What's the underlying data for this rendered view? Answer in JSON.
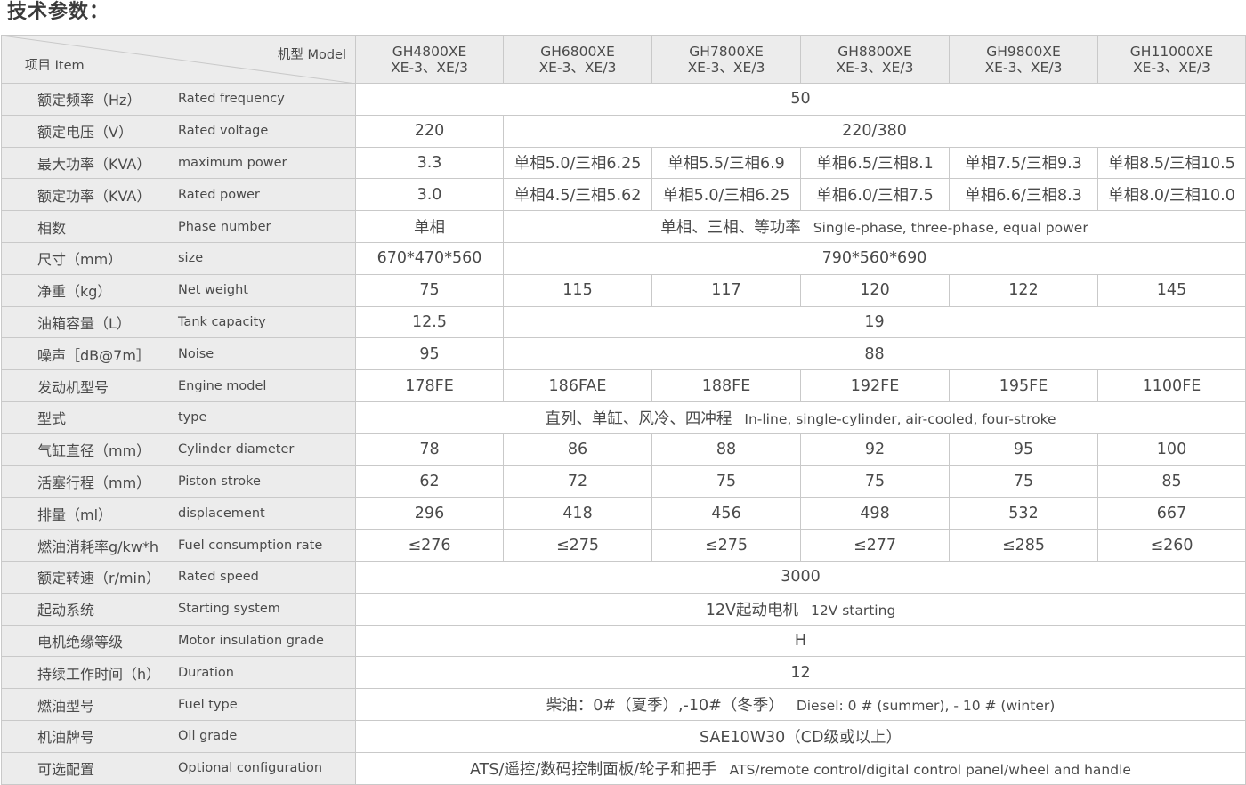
{
  "title": "技术参数：",
  "header": {
    "model_label": "机型 Model",
    "item_label": "项目 Item",
    "columns": [
      {
        "line1": "GH4800XE",
        "line2": "XE-3、XE/3"
      },
      {
        "line1": "GH6800XE",
        "line2": "XE-3、XE/3"
      },
      {
        "line1": "GH7800XE",
        "line2": "XE-3、XE/3"
      },
      {
        "line1": "GH8800XE",
        "line2": "XE-3、XE/3"
      },
      {
        "line1": "GH9800XE",
        "line2": "XE-3、XE/3"
      },
      {
        "line1": "GH11000XE",
        "line2": "XE-3、XE/3"
      }
    ]
  },
  "rows": [
    {
      "cn": "额定频率（Hz）",
      "en": "Rated frequency",
      "cells": [
        {
          "text": "50",
          "span": 6
        }
      ]
    },
    {
      "cn": "额定电压（V）",
      "en": "Rated voltage",
      "cells": [
        {
          "text": "220",
          "span": 1
        },
        {
          "text": "220/380",
          "span": 5
        }
      ]
    },
    {
      "cn": "最大功率（KVA）",
      "en": "maximum power",
      "cells": [
        {
          "text": "3.3",
          "span": 1
        },
        {
          "text": "单相5.0/三相6.25",
          "span": 1
        },
        {
          "text": "单相5.5/三相6.9",
          "span": 1
        },
        {
          "text": "单相6.5/三相8.1",
          "span": 1
        },
        {
          "text": "单相7.5/三相9.3",
          "span": 1
        },
        {
          "text": "单相8.5/三相10.5",
          "span": 1
        }
      ]
    },
    {
      "cn": "额定功率（KVA）",
      "en": "Rated power",
      "cells": [
        {
          "text": "3.0",
          "span": 1
        },
        {
          "text": "单相4.5/三相5.62",
          "span": 1
        },
        {
          "text": "单相5.0/三相6.25",
          "span": 1
        },
        {
          "text": "单相6.0/三相7.5",
          "span": 1
        },
        {
          "text": "单相6.6/三相8.3",
          "span": 1
        },
        {
          "text": "单相8.0/三相10.0",
          "span": 1
        }
      ]
    },
    {
      "cn": "相数",
      "en": "Phase number",
      "cells": [
        {
          "text": "单相",
          "span": 1
        },
        {
          "text": "单相、三相、等功率",
          "en": "Single-phase, three-phase, equal power",
          "span": 5
        }
      ]
    },
    {
      "cn": "尺寸（mm）",
      "en": "size",
      "cells": [
        {
          "text": "670*470*560",
          "span": 1
        },
        {
          "text": "790*560*690",
          "span": 5
        }
      ]
    },
    {
      "cn": "净重（kg）",
      "en": "Net weight",
      "cells": [
        {
          "text": "75",
          "span": 1
        },
        {
          "text": "115",
          "span": 1
        },
        {
          "text": "117",
          "span": 1
        },
        {
          "text": "120",
          "span": 1
        },
        {
          "text": "122",
          "span": 1
        },
        {
          "text": "145",
          "span": 1
        }
      ]
    },
    {
      "cn": "油箱容量（L）",
      "en": "Tank capacity",
      "cells": [
        {
          "text": "12.5",
          "span": 1
        },
        {
          "text": "19",
          "span": 5
        }
      ]
    },
    {
      "cn": "噪声［dB@7m］",
      "en": "Noise",
      "cells": [
        {
          "text": "95",
          "span": 1
        },
        {
          "text": "88",
          "span": 5
        }
      ]
    },
    {
      "cn": "发动机型号",
      "en": "Engine model",
      "cells": [
        {
          "text": "178FE",
          "span": 1
        },
        {
          "text": "186FAE",
          "span": 1
        },
        {
          "text": "188FE",
          "span": 1
        },
        {
          "text": "192FE",
          "span": 1
        },
        {
          "text": "195FE",
          "span": 1
        },
        {
          "text": "1100FE",
          "span": 1
        }
      ]
    },
    {
      "cn": "型式",
      "en": "type",
      "cells": [
        {
          "text": "直列、单缸、风冷、四冲程",
          "en": "In-line, single-cylinder, air-cooled, four-stroke",
          "span": 6
        }
      ]
    },
    {
      "cn": "气缸直径（mm）",
      "en": "Cylinder diameter",
      "cells": [
        {
          "text": "78",
          "span": 1
        },
        {
          "text": "86",
          "span": 1
        },
        {
          "text": "88",
          "span": 1
        },
        {
          "text": "92",
          "span": 1
        },
        {
          "text": "95",
          "span": 1
        },
        {
          "text": "100",
          "span": 1
        }
      ]
    },
    {
      "cn": "活塞行程（mm）",
      "en": "Piston stroke",
      "cells": [
        {
          "text": "62",
          "span": 1
        },
        {
          "text": "72",
          "span": 1
        },
        {
          "text": "75",
          "span": 1
        },
        {
          "text": "75",
          "span": 1
        },
        {
          "text": "75",
          "span": 1
        },
        {
          "text": "85",
          "span": 1
        }
      ]
    },
    {
      "cn": "排量（ml）",
      "en": "displacement",
      "cells": [
        {
          "text": "296",
          "span": 1
        },
        {
          "text": "418",
          "span": 1
        },
        {
          "text": "456",
          "span": 1
        },
        {
          "text": "498",
          "span": 1
        },
        {
          "text": "532",
          "span": 1
        },
        {
          "text": "667",
          "span": 1
        }
      ]
    },
    {
      "cn": "燃油消耗率g/kw*h",
      "en": "Fuel consumption rate",
      "cells": [
        {
          "text": "≤276",
          "span": 1
        },
        {
          "text": "≤275",
          "span": 1
        },
        {
          "text": "≤275",
          "span": 1
        },
        {
          "text": "≤277",
          "span": 1
        },
        {
          "text": "≤285",
          "span": 1
        },
        {
          "text": "≤260",
          "span": 1
        }
      ]
    },
    {
      "cn": "额定转速（r/min）",
      "en": "Rated speed",
      "cells": [
        {
          "text": "3000",
          "span": 6
        }
      ]
    },
    {
      "cn": "起动系统",
      "en": "Starting system",
      "cells": [
        {
          "text": "12V起动电机",
          "en": "12V starting",
          "span": 6
        }
      ]
    },
    {
      "cn": "电机绝缘等级",
      "en": "Motor insulation grade",
      "cells": [
        {
          "text": "H",
          "span": 6
        }
      ]
    },
    {
      "cn": "持续工作时间（h）",
      "en": "Duration",
      "cells": [
        {
          "text": "12",
          "span": 6
        }
      ]
    },
    {
      "cn": "燃油型号",
      "en": "Fuel type",
      "cells": [
        {
          "text": "柴油：0#（夏季）,-10#（冬季）",
          "en": "Diesel: 0 # (summer), - 10 # (winter)",
          "span": 6
        }
      ]
    },
    {
      "cn": "机油牌号",
      "en": "Oil grade",
      "cells": [
        {
          "text": "SAE10W30（CD级或以上）",
          "span": 6
        }
      ]
    },
    {
      "cn": "可选配置",
      "en": "Optional configuration",
      "cells": [
        {
          "text": "ATS/遥控/数码控制面板/轮子和把手",
          "en": "ATS/remote control/digital control panel/wheel and handle",
          "span": 6
        }
      ]
    }
  ]
}
